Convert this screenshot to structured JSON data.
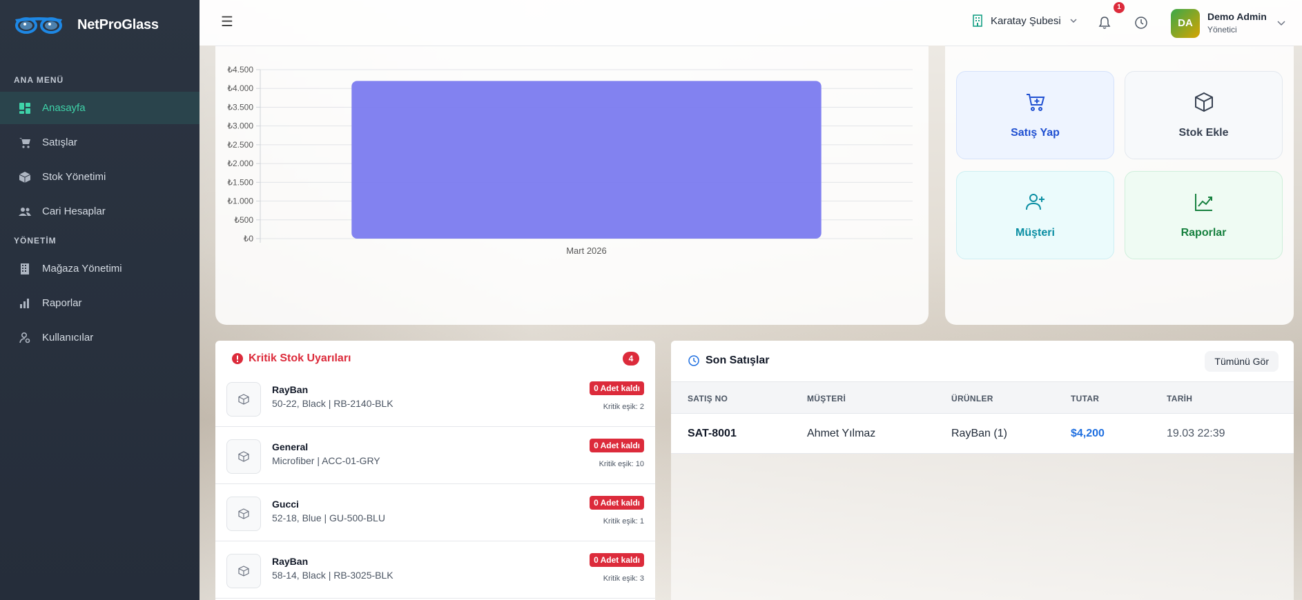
{
  "brand": {
    "name": "NetProGlass",
    "logo_icon": "glasses-icon"
  },
  "sidebar": {
    "sections": [
      {
        "title": "ANA MENÜ"
      },
      {
        "title": "YÖNETİM"
      }
    ],
    "items": [
      {
        "label": "Anasayfa",
        "icon": "dashboard-icon",
        "active": true
      },
      {
        "label": "Satışlar",
        "icon": "cart-icon"
      },
      {
        "label": "Stok Yönetimi",
        "icon": "box-icon"
      },
      {
        "label": "Cari Hesaplar",
        "icon": "users-icon"
      },
      {
        "label": "Mağaza Yönetimi",
        "icon": "building-icon"
      },
      {
        "label": "Raporlar",
        "icon": "bar-chart-icon"
      },
      {
        "label": "Kullanıcılar",
        "icon": "user-gear-icon"
      }
    ]
  },
  "header": {
    "menu_icon": "☰",
    "branch": "Karatay Şubesi",
    "notification_count": "1",
    "user": {
      "initials": "DA",
      "name": "Demo Admin",
      "role": "Yönetici"
    }
  },
  "chart_data": {
    "type": "bar",
    "categories": [
      "Mart 2026"
    ],
    "values": [
      4200
    ],
    "ylim": [
      0,
      4500
    ],
    "yticks": [
      0,
      500,
      1000,
      1500,
      2000,
      2500,
      3000,
      3500,
      4000,
      4500
    ],
    "ytick_labels": [
      "₺0",
      "₺500",
      "₺1.000",
      "₺1.500",
      "₺2.000",
      "₺2.500",
      "₺3.000",
      "₺3.500",
      "₺4.000",
      "₺4.500"
    ],
    "grid": true,
    "bar_color": "#7b7bef"
  },
  "quick_actions": {
    "sale": "Satış Yap",
    "stock": "Stok Ekle",
    "customer": "Müşteri",
    "reports": "Raporlar"
  },
  "critical_stock": {
    "title": "Kritik Stok Uyarıları",
    "count": "4",
    "items": [
      {
        "name": "RayBan",
        "desc": "50-22, Black | RB-2140-BLK",
        "qty": "0 Adet kaldı",
        "threshold": "Kritik eşik: 2"
      },
      {
        "name": "General",
        "desc": "Microfiber | ACC-01-GRY",
        "qty": "0 Adet kaldı",
        "threshold": "Kritik eşik: 10"
      },
      {
        "name": "Gucci",
        "desc": "52-18, Blue | GU-500-BLU",
        "qty": "0 Adet kaldı",
        "threshold": "Kritik eşik: 1"
      },
      {
        "name": "RayBan",
        "desc": "58-14, Black | RB-3025-BLK",
        "qty": "0 Adet kaldı",
        "threshold": "Kritik eşik: 3"
      }
    ]
  },
  "recent_sales": {
    "title": "Son Satışlar",
    "see_all": "Tümünü Gör",
    "columns": [
      "SATIŞ NO",
      "MÜŞTERİ",
      "ÜRÜNLER",
      "TUTAR",
      "TARİH"
    ],
    "rows": [
      {
        "no": "SAT-8001",
        "customer": "Ahmet Yılmaz",
        "products": "RayBan (1)",
        "amount": "$4,200",
        "date": "19.03 22:39"
      }
    ]
  }
}
